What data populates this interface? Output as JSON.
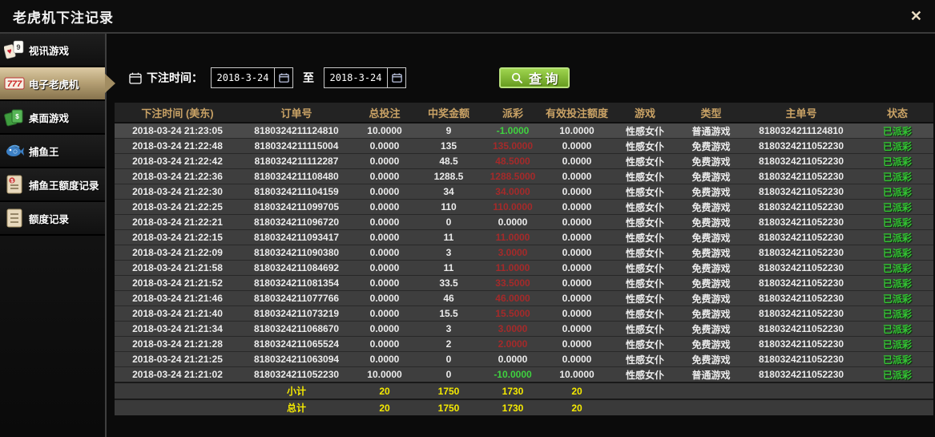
{
  "window": {
    "title": "老虎机下注记录",
    "close_icon": "✕"
  },
  "sidebar": {
    "items": [
      {
        "label": "视讯游戏",
        "icon": "cards-icon",
        "selected": false
      },
      {
        "label": "电子老虎机",
        "icon": "slots-777-icon",
        "selected": true
      },
      {
        "label": "桌面游戏",
        "icon": "table-games-icon",
        "selected": false
      },
      {
        "label": "捕鱼王",
        "icon": "fish-icon",
        "selected": false
      },
      {
        "label": "捕鱼王额度记录",
        "icon": "doc-money-icon",
        "selected": false
      },
      {
        "label": "额度记录",
        "icon": "doc-icon",
        "selected": false
      }
    ]
  },
  "filter": {
    "label": "下注时间：",
    "date_from": "2018-3-24",
    "to_label": "至",
    "date_to": "2018-3-24",
    "search_label": "查 询"
  },
  "table": {
    "headers": [
      "下注时间 (美东)",
      "订单号",
      "总投注",
      "中奖金额",
      "派彩",
      "有效投注额度",
      "游戏",
      "类型",
      "主单号",
      "状态"
    ],
    "rows": [
      {
        "time": "2018-03-24 21:23:05",
        "order_no": "8180324211124810",
        "total_bet": "10.0000",
        "win_amount": "9",
        "payout": "-1.0000",
        "payout_color": "green",
        "valid_bet": "10.0000",
        "game": "性感女仆",
        "type": "普通游戏",
        "master_no": "8180324211124810",
        "status": "已派彩"
      },
      {
        "time": "2018-03-24 21:22:48",
        "order_no": "8180324211115004",
        "total_bet": "0.0000",
        "win_amount": "135",
        "payout": "135.0000",
        "payout_color": "red",
        "valid_bet": "0.0000",
        "game": "性感女仆",
        "type": "免费游戏",
        "master_no": "8180324211052230",
        "status": "已派彩"
      },
      {
        "time": "2018-03-24 21:22:42",
        "order_no": "8180324211112287",
        "total_bet": "0.0000",
        "win_amount": "48.5",
        "payout": "48.5000",
        "payout_color": "red",
        "valid_bet": "0.0000",
        "game": "性感女仆",
        "type": "免费游戏",
        "master_no": "8180324211052230",
        "status": "已派彩"
      },
      {
        "time": "2018-03-24 21:22:36",
        "order_no": "8180324211108480",
        "total_bet": "0.0000",
        "win_amount": "1288.5",
        "payout": "1288.5000",
        "payout_color": "red",
        "valid_bet": "0.0000",
        "game": "性感女仆",
        "type": "免费游戏",
        "master_no": "8180324211052230",
        "status": "已派彩"
      },
      {
        "time": "2018-03-24 21:22:30",
        "order_no": "8180324211104159",
        "total_bet": "0.0000",
        "win_amount": "34",
        "payout": "34.0000",
        "payout_color": "red",
        "valid_bet": "0.0000",
        "game": "性感女仆",
        "type": "免费游戏",
        "master_no": "8180324211052230",
        "status": "已派彩"
      },
      {
        "time": "2018-03-24 21:22:25",
        "order_no": "8180324211099705",
        "total_bet": "0.0000",
        "win_amount": "110",
        "payout": "110.0000",
        "payout_color": "red",
        "valid_bet": "0.0000",
        "game": "性感女仆",
        "type": "免费游戏",
        "master_no": "8180324211052230",
        "status": "已派彩"
      },
      {
        "time": "2018-03-24 21:22:21",
        "order_no": "8180324211096720",
        "total_bet": "0.0000",
        "win_amount": "0",
        "payout": "0.0000",
        "payout_color": "white",
        "valid_bet": "0.0000",
        "game": "性感女仆",
        "type": "免费游戏",
        "master_no": "8180324211052230",
        "status": "已派彩"
      },
      {
        "time": "2018-03-24 21:22:15",
        "order_no": "8180324211093417",
        "total_bet": "0.0000",
        "win_amount": "11",
        "payout": "11.0000",
        "payout_color": "red",
        "valid_bet": "0.0000",
        "game": "性感女仆",
        "type": "免费游戏",
        "master_no": "8180324211052230",
        "status": "已派彩"
      },
      {
        "time": "2018-03-24 21:22:09",
        "order_no": "8180324211090380",
        "total_bet": "0.0000",
        "win_amount": "3",
        "payout": "3.0000",
        "payout_color": "red",
        "valid_bet": "0.0000",
        "game": "性感女仆",
        "type": "免费游戏",
        "master_no": "8180324211052230",
        "status": "已派彩"
      },
      {
        "time": "2018-03-24 21:21:58",
        "order_no": "8180324211084692",
        "total_bet": "0.0000",
        "win_amount": "11",
        "payout": "11.0000",
        "payout_color": "red",
        "valid_bet": "0.0000",
        "game": "性感女仆",
        "type": "免费游戏",
        "master_no": "8180324211052230",
        "status": "已派彩"
      },
      {
        "time": "2018-03-24 21:21:52",
        "order_no": "8180324211081354",
        "total_bet": "0.0000",
        "win_amount": "33.5",
        "payout": "33.5000",
        "payout_color": "red",
        "valid_bet": "0.0000",
        "game": "性感女仆",
        "type": "免费游戏",
        "master_no": "8180324211052230",
        "status": "已派彩"
      },
      {
        "time": "2018-03-24 21:21:46",
        "order_no": "8180324211077766",
        "total_bet": "0.0000",
        "win_amount": "46",
        "payout": "46.0000",
        "payout_color": "red",
        "valid_bet": "0.0000",
        "game": "性感女仆",
        "type": "免费游戏",
        "master_no": "8180324211052230",
        "status": "已派彩"
      },
      {
        "time": "2018-03-24 21:21:40",
        "order_no": "8180324211073219",
        "total_bet": "0.0000",
        "win_amount": "15.5",
        "payout": "15.5000",
        "payout_color": "red",
        "valid_bet": "0.0000",
        "game": "性感女仆",
        "type": "免费游戏",
        "master_no": "8180324211052230",
        "status": "已派彩"
      },
      {
        "time": "2018-03-24 21:21:34",
        "order_no": "8180324211068670",
        "total_bet": "0.0000",
        "win_amount": "3",
        "payout": "3.0000",
        "payout_color": "red",
        "valid_bet": "0.0000",
        "game": "性感女仆",
        "type": "免费游戏",
        "master_no": "8180324211052230",
        "status": "已派彩"
      },
      {
        "time": "2018-03-24 21:21:28",
        "order_no": "8180324211065524",
        "total_bet": "0.0000",
        "win_amount": "2",
        "payout": "2.0000",
        "payout_color": "red",
        "valid_bet": "0.0000",
        "game": "性感女仆",
        "type": "免费游戏",
        "master_no": "8180324211052230",
        "status": "已派彩"
      },
      {
        "time": "2018-03-24 21:21:25",
        "order_no": "8180324211063094",
        "total_bet": "0.0000",
        "win_amount": "0",
        "payout": "0.0000",
        "payout_color": "white",
        "valid_bet": "0.0000",
        "game": "性感女仆",
        "type": "免费游戏",
        "master_no": "8180324211052230",
        "status": "已派彩"
      },
      {
        "time": "2018-03-24 21:21:02",
        "order_no": "8180324211052230",
        "total_bet": "10.0000",
        "win_amount": "0",
        "payout": "-10.0000",
        "payout_color": "green",
        "valid_bet": "10.0000",
        "game": "性感女仆",
        "type": "普通游戏",
        "master_no": "8180324211052230",
        "status": "已派彩"
      }
    ],
    "summary": [
      {
        "label": "小计",
        "total_bet": "20",
        "win_amount": "1750",
        "payout": "1730",
        "valid_bet": "20"
      },
      {
        "label": "总计",
        "total_bet": "20",
        "win_amount": "1750",
        "payout": "1730",
        "valid_bet": "20"
      }
    ]
  },
  "colors": {
    "header_text": "#c9a265",
    "payout_red": "#a52a2a",
    "payout_green": "#3fd23f",
    "status_green": "#35c435",
    "summary_yellow": "#f5ea00",
    "button_green": "#7cb335",
    "selected_tan": "#b7a276"
  }
}
